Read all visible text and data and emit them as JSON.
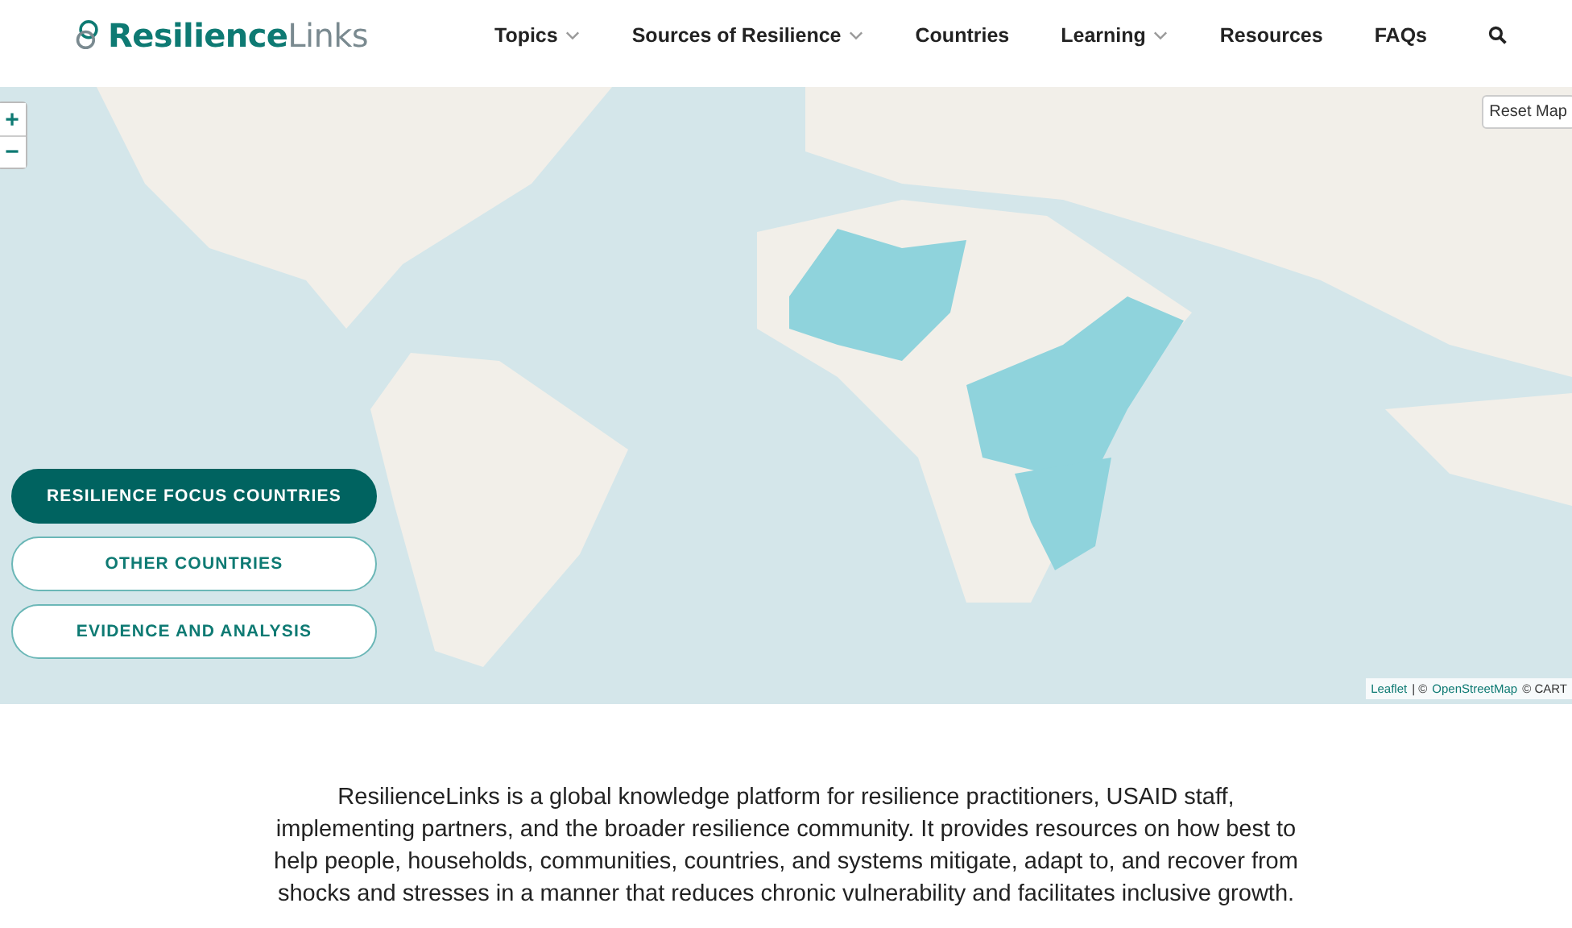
{
  "header": {
    "logo": "**Resilience**Links",
    "nav": [
      {
        "label": "Topics",
        "dropdown": true
      },
      {
        "label": "Sources of Resilience",
        "dropdown": true
      },
      {
        "label": "Countries",
        "dropdown": false
      },
      {
        "label": "Learning",
        "dropdown": true
      },
      {
        "label": "Resources",
        "dropdown": false
      },
      {
        "label": "FAQs",
        "dropdown": false
      }
    ]
  },
  "map": {
    "zoom_in": "+",
    "zoom_out": "−",
    "reset": "Reset Map",
    "attribution": [
      {
        "kind": "link",
        "text": "Leaflet"
      },
      {
        "kind": "text",
        "text": "| ©"
      },
      {
        "kind": "link",
        "text": "OpenStreetMap"
      },
      {
        "kind": "text",
        "text": "© CART"
      }
    ],
    "layers": [
      {
        "label": "RESILIENCE FOCUS COUNTRIES",
        "selected": true
      },
      {
        "label": "OTHER COUNTRIES",
        "selected": false
      },
      {
        "label": "EVIDENCE AND ANALYSIS",
        "selected": false
      }
    ]
  },
  "intro": "ResilienceLinks is a global knowledge platform for resilience practitioners, USAID staff, implementing partners, and the broader resilience community. It provides resources on how best to help people, households, communities, countries, and systems mitigate, adapt to, and recover from shocks and stresses in a manner that reduces chronic vulnerability and facilitates inclusive growth."
}
